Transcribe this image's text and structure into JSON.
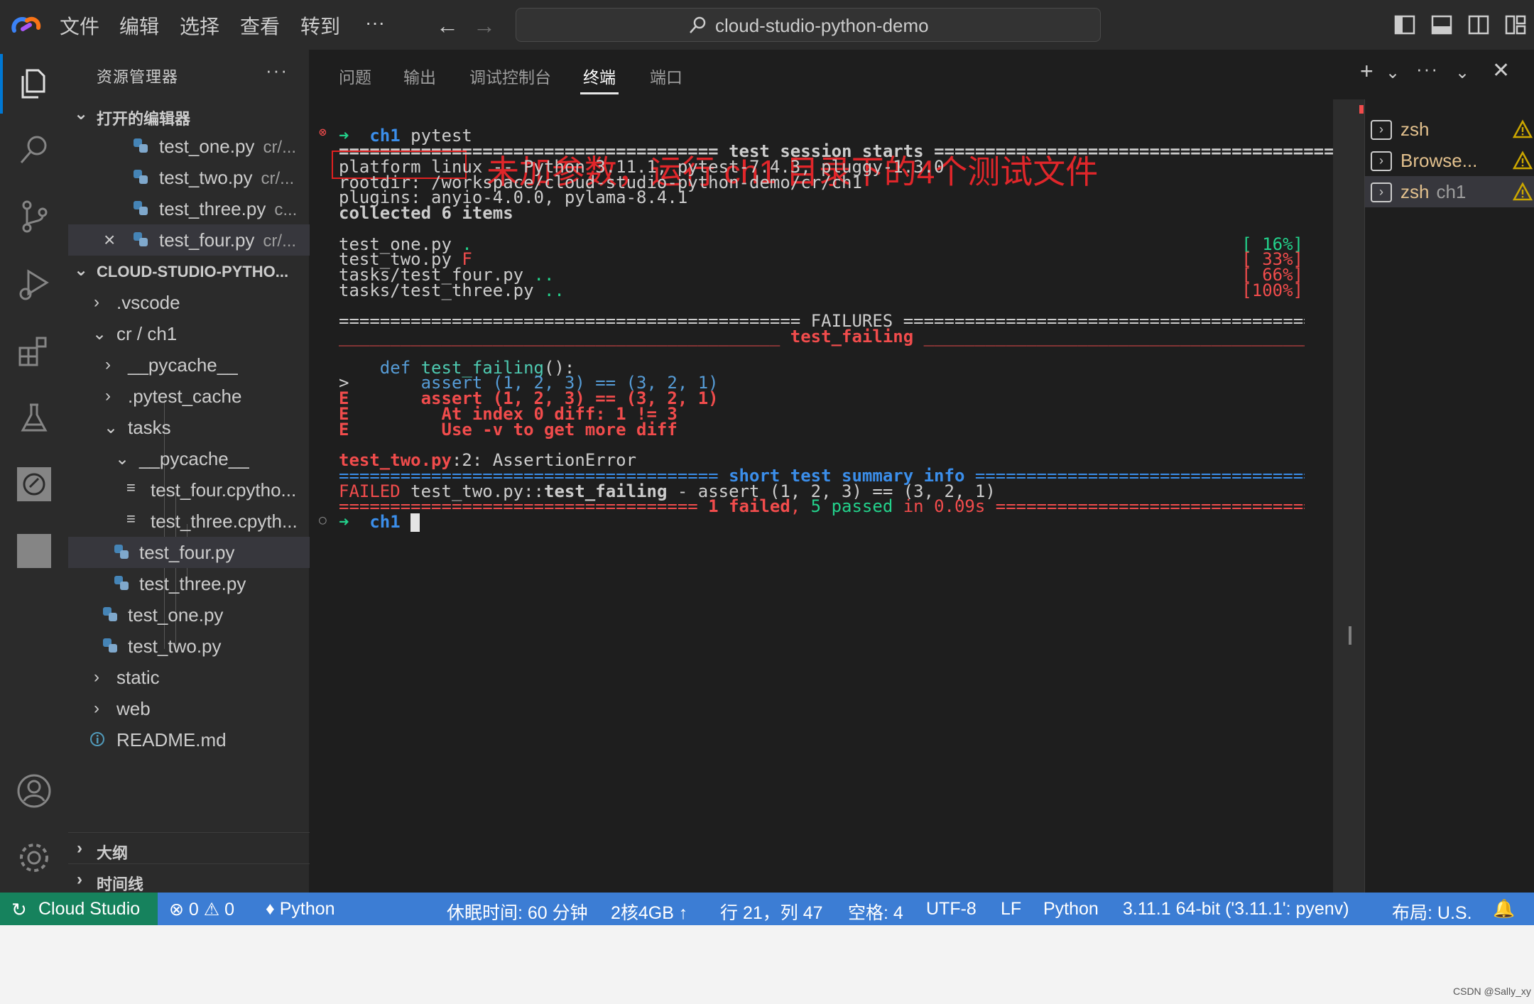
{
  "titlebar": {
    "menus": [
      "文件",
      "编辑",
      "选择",
      "查看",
      "转到",
      "···"
    ],
    "command_center": "cloud-studio-python-demo"
  },
  "sidebar": {
    "title": "资源管理器",
    "more": "···",
    "open_editors": {
      "label": "打开的编辑器",
      "items": [
        {
          "name": "test_one.py",
          "desc": "cr/..."
        },
        {
          "name": "test_two.py",
          "desc": "cr/..."
        },
        {
          "name": "test_three.py",
          "desc": "c..."
        },
        {
          "name": "test_four.py",
          "desc": "cr/..."
        }
      ]
    },
    "workspace": {
      "label": "CLOUD-STUDIO-PYTHO...",
      "items": [
        {
          "name": ".vscode"
        },
        {
          "name": "cr / ch1"
        },
        {
          "name": "__pycache__"
        },
        {
          "name": ".pytest_cache"
        },
        {
          "name": "tasks"
        },
        {
          "name": "__pycache__"
        },
        {
          "name": "test_four.cpytho..."
        },
        {
          "name": "test_three.cpyth..."
        },
        {
          "name": "test_four.py"
        },
        {
          "name": "test_three.py"
        },
        {
          "name": "test_one.py"
        },
        {
          "name": "test_two.py"
        },
        {
          "name": "static"
        },
        {
          "name": "web"
        },
        {
          "name": "README.md"
        }
      ]
    },
    "outline": "大纲",
    "timeline": "时间线"
  },
  "panel": {
    "tabs": [
      "问题",
      "输出",
      "调试控制台",
      "终端",
      "端口"
    ],
    "active_tab": "终端"
  },
  "terminal": {
    "prompt_dir": "ch1",
    "command": "pytest",
    "annotation": "未加参数，运行 ch1 目录下的4个测试文件",
    "session_header_left": "=====================================",
    "session_header_text": " test session starts ",
    "session_header_right": "============================================",
    "platform": "platform linux -- Python 3.11.1, pytest-7.4.3, pluggy-1.3.0",
    "rootdir": "rootdir: /workspace/cloud-studio-python-demo/cr/ch1",
    "plugins": "plugins: anyio-4.0.0, pylama-8.4.1",
    "collected": "collected 6 items",
    "results": [
      {
        "file": "test_one.py ",
        "marks": ".",
        "pct": "[ 16%]"
      },
      {
        "file": "test_two.py ",
        "marks": "F",
        "pct": "[ 33%]"
      },
      {
        "file": "tasks/test_four.py ",
        "marks": "..",
        "pct": "[ 66%]"
      },
      {
        "file": "tasks/test_three.py ",
        "marks": "..",
        "pct": "[100%]"
      }
    ],
    "failures_header": "============================================= FAILURES =============================================",
    "failing_left": "___________________________________________",
    "failing_name": " test_failing ",
    "failing_right": "_____________________________________________",
    "code_def_kw": "    def ",
    "code_def_name": "test_failing",
    "code_def_rest": "():",
    "code_assert_prefix": ">       ",
    "code_assert": "assert (1, 2, 3) == (3, 2, 1)",
    "err_lines": [
      "E       assert (1, 2, 3) == (3, 2, 1)",
      "E         At index 0 diff: 1 != 3",
      "E         Use -v to get more diff"
    ],
    "trace_file": "test_two.py",
    "trace_rest": ":2: AssertionError",
    "summary_left": "=====================================",
    "summary_text": " short test summary info ",
    "summary_right": "========================================",
    "failed_label": "FAILED",
    "failed_path": " test_two.py::",
    "failed_func": "test_failing",
    "failed_rest": " - assert (1, 2, 3) == (3, 2, 1)",
    "final_left": "=================================== ",
    "final_failed": "1 failed",
    "final_sep": ", ",
    "final_passed": "5 passed",
    "final_time": " in 0.09s",
    "final_right": " ====================================",
    "prompt2_dir": "ch1"
  },
  "terminal_list": [
    {
      "name": "zsh",
      "sub": ""
    },
    {
      "name": "Browse...",
      "sub": ""
    },
    {
      "name": "zsh",
      "sub": "ch1"
    }
  ],
  "statusbar": {
    "remote": "Cloud Studio",
    "errors": "0",
    "warnings": "0",
    "python": "Python",
    "sleep": "休眠时间: 60 分钟",
    "resources": "2核4GB",
    "position": "行 21，列 47",
    "spaces": "空格: 4",
    "encoding": "UTF-8",
    "eol": "LF",
    "language": "Python",
    "interpreter": "3.11.1 64-bit ('3.11.1': pyenv)",
    "layout": "布局: U.S."
  },
  "watermark": "CSDN @Sally_xy",
  "colors": {
    "accent": "#0078d4",
    "statusbar": "#3c7dd4",
    "remote": "#16825d",
    "error": "#f14c4c",
    "success": "#23d18b",
    "annotation": "#e0262a"
  }
}
